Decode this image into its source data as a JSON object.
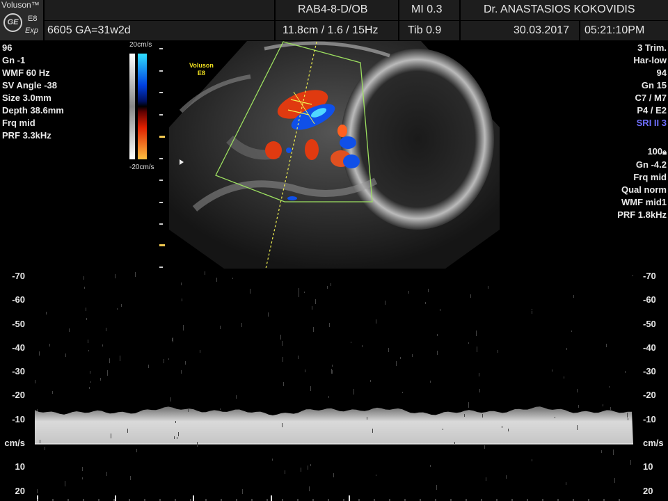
{
  "header": {
    "brand": "Voluson™",
    "model": "E8",
    "edition": "Exp",
    "logo": "ge-monogram-icon",
    "probe": "RAB4-8-D/OB",
    "mi": "MI  0.3",
    "operator": "Dr. ANASTASIOS KOKOVIDIS",
    "patient_info": "6605  GA=31w2d",
    "depth_freq": "11.8cm / 1.6 / 15Hz",
    "tib": "Tib  0.9",
    "date": "30.03.2017",
    "time": "05:21:10PM"
  },
  "left_params": [
    "96",
    "Gn  -1",
    "WMF 60 Hz",
    "SV Angle -38",
    "Size  3.0mm",
    "Depth 38.6mm",
    "Frq mid",
    "PRF  3.3kHz"
  ],
  "right_params_top": [
    "3 Trim.",
    "Har-low",
    "94",
    "Gn  15",
    "C7 / M7",
    "P4 / E2",
    "SRI II 3"
  ],
  "right_params_bottom": [
    "100",
    "Gn -4.2",
    "Frq mid",
    "Qual norm",
    "WMF mid1",
    "PRF  1.8kHz"
  ],
  "color_bar": {
    "top_label": "20cm/s",
    "bottom_label": "-20cm/s"
  },
  "image_brand": {
    "line1": "Voluson",
    "line2": "E8"
  },
  "spectrum": {
    "unit": "cm/s",
    "scale_labels": [
      {
        "value": -70,
        "label": "-70"
      },
      {
        "value": -60,
        "label": "-60"
      },
      {
        "value": -50,
        "label": "-50"
      },
      {
        "value": -40,
        "label": "-40"
      },
      {
        "value": -30,
        "label": "-30"
      },
      {
        "value": -20,
        "label": "-20"
      },
      {
        "value": -10,
        "label": "-10"
      },
      {
        "value": 10,
        "label": "10"
      },
      {
        "value": 20,
        "label": "20"
      }
    ],
    "flow_velocity_range_cm_s": [
      -15,
      0
    ]
  },
  "colors": {
    "header_bg": "#1d1d1d",
    "doppler_red": "#e03a10",
    "doppler_blue": "#1050e8",
    "sample_line": "#f0f050",
    "sector_outline": "#9de060"
  }
}
